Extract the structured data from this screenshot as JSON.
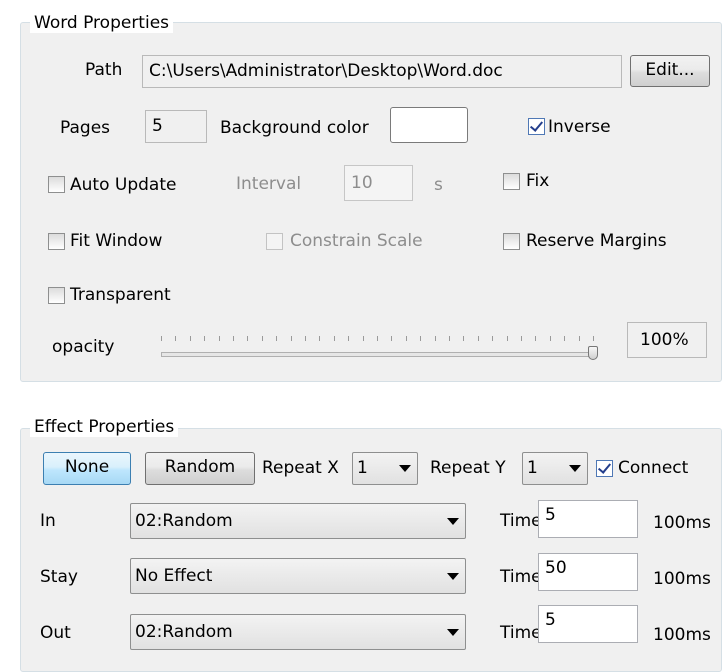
{
  "word_properties": {
    "title": "Word Properties",
    "path_label": "Path",
    "path_value": "C:\\Users\\Administrator\\Desktop\\Word.doc",
    "edit_button": "Edit...",
    "pages_label": "Pages",
    "pages_value": "5",
    "background_color_label": "Background color",
    "background_color_value": "#ffffff",
    "inverse_label": "Inverse",
    "inverse_checked": true,
    "auto_update_label": "Auto Update",
    "auto_update_checked": false,
    "interval_label": "Interval",
    "interval_value": "10",
    "interval_unit": "s",
    "fix_label": "Fix",
    "fix_checked": false,
    "fit_window_label": "Fit Window",
    "fit_window_checked": false,
    "constrain_scale_label": "Constrain Scale",
    "constrain_scale_checked": false,
    "reserve_margins_label": "Reserve Margins",
    "reserve_margins_checked": false,
    "transparent_label": "Transparent",
    "transparent_checked": false,
    "opacity_label": "opacity",
    "opacity_value": "100%",
    "opacity_fraction": 1.0
  },
  "effect_properties": {
    "title": "Effect Properties",
    "none_button": "None",
    "random_button": "Random",
    "repeat_x_label": "Repeat X",
    "repeat_x_value": "1",
    "repeat_y_label": "Repeat Y",
    "repeat_y_value": "1",
    "connect_label": "Connect",
    "connect_checked": true,
    "rows": [
      {
        "label": "In",
        "effect": "02:Random",
        "time_label": "Time",
        "time_value": "5",
        "unit": "100ms"
      },
      {
        "label": "Stay",
        "effect": "No Effect",
        "time_label": "Time",
        "time_value": "50",
        "unit": "100ms"
      },
      {
        "label": "Out",
        "effect": "02:Random",
        "time_label": "Time",
        "time_value": "5",
        "unit": "100ms"
      }
    ]
  }
}
